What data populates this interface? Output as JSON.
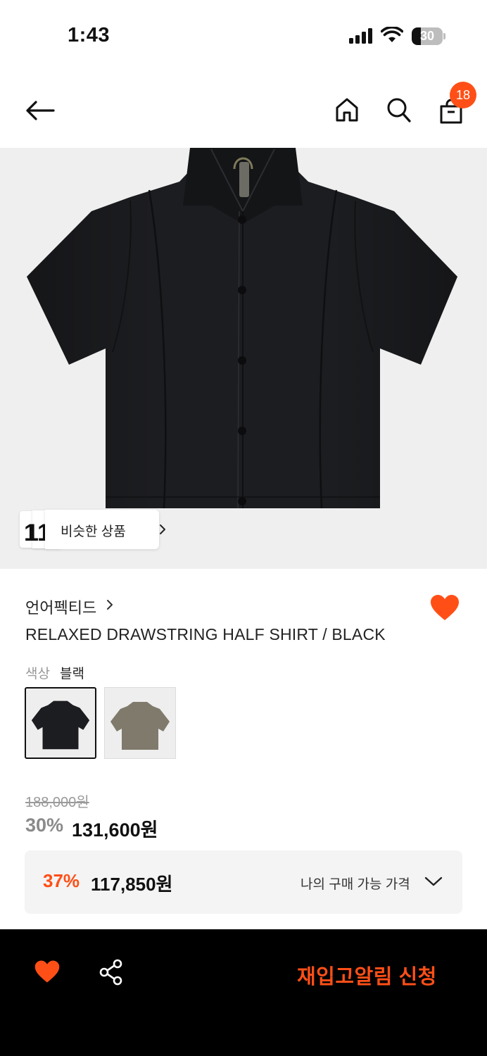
{
  "status_bar": {
    "time": "1:43",
    "battery": "30",
    "battery_level": 0.3
  },
  "nav": {
    "cart_count": "18"
  },
  "hero": {
    "similar_label": "비슷한 상품",
    "thumb_text": "11"
  },
  "product": {
    "brand": "언어펙티드",
    "name": "RELAXED DRAWSTRING HALF SHIRT / BLACK",
    "color_label": "색상",
    "color_value": "블랙",
    "swatches": [
      {
        "name": "black",
        "color": "#1c1d20"
      },
      {
        "name": "khaki",
        "color": "#7f7a6c"
      }
    ]
  },
  "price": {
    "original": "188,000원",
    "discount_rate": "30%",
    "sale": "131,600원",
    "my_rate": "37%",
    "my_price": "117,850원",
    "my_label": "나의 구매 가능 가격"
  },
  "bottom_bar": {
    "restock_label": "재입고알림 신청"
  },
  "colors": {
    "accent": "#ff4f17",
    "shirt": "#1c1d20"
  }
}
